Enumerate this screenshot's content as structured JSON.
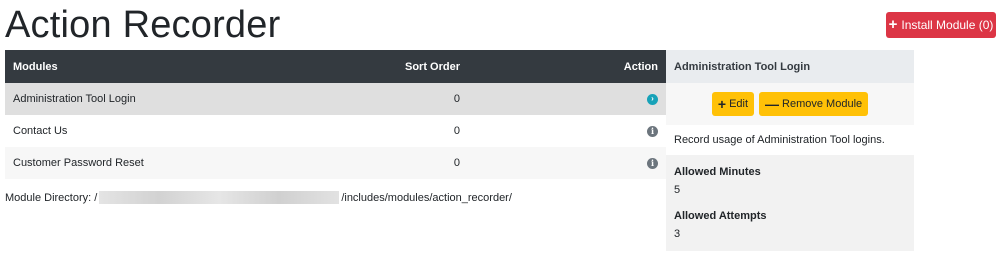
{
  "page": {
    "title": "Action Recorder"
  },
  "install_button": {
    "icon": "plus-icon",
    "label": "Install Module (0)",
    "color": "#dc3545"
  },
  "table": {
    "headers": {
      "modules": "Modules",
      "sort_order": "Sort Order",
      "action": "Action"
    },
    "rows": [
      {
        "name": "Administration Tool Login",
        "sort_order": "0",
        "action_icon": "chevron-right-circle-icon",
        "selected": true
      },
      {
        "name": "Contact Us",
        "sort_order": "0",
        "action_icon": "info-circle-icon",
        "selected": false
      },
      {
        "name": "Customer Password Reset",
        "sort_order": "0",
        "action_icon": "info-circle-icon",
        "selected": false
      }
    ]
  },
  "module_directory": {
    "label": "Module Directory: /",
    "path_suffix": "/includes/modules/action_recorder/"
  },
  "side_panel": {
    "title": "Administration Tool Login",
    "edit_label": "Edit",
    "remove_label": "Remove Module",
    "description": "Record usage of Administration Tool logins.",
    "fields": [
      {
        "label": "Allowed Minutes",
        "value": "5"
      },
      {
        "label": "Allowed Attempts",
        "value": "3"
      }
    ],
    "button_color": "#ffc107"
  }
}
